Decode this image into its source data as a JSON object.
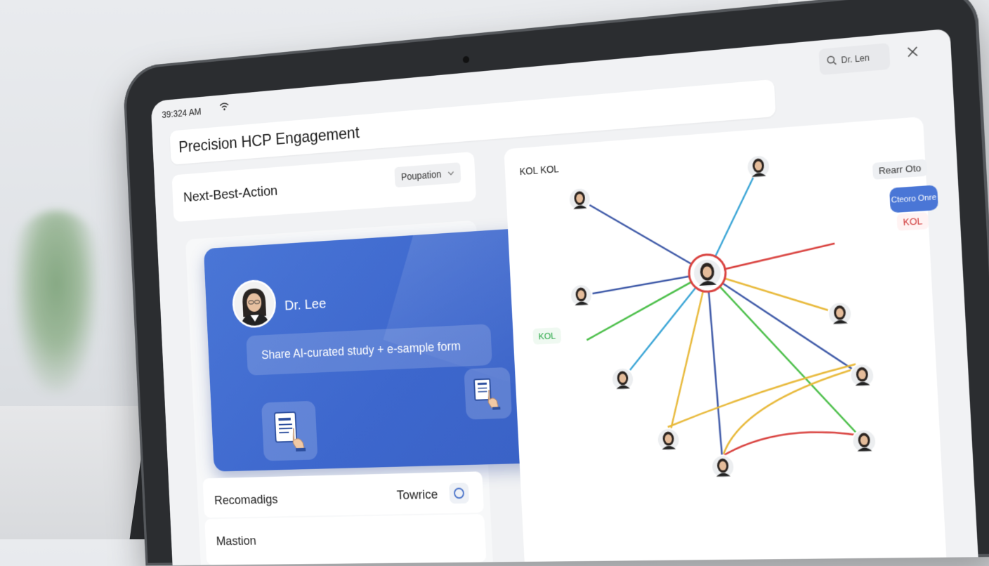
{
  "statusbar": {
    "time": "39:324 AM",
    "search_text": "Dr. Len"
  },
  "header": {
    "title": "Precision HCP Engagement"
  },
  "next_best_action": {
    "label": "Next-Best-Action",
    "dropdown_value": "Poupation"
  },
  "recommendation": {
    "doctor_name": "Dr. Lee",
    "action_text": "Share AI-curated study + e-sample form"
  },
  "list": {
    "row1_label": "Recomadigs",
    "row1_right": "Towrice",
    "row2_label": "Mastion"
  },
  "network": {
    "title": "KOL KOL",
    "tags": {
      "top": "Rearr Oto",
      "blue": "Cteoro Onre",
      "red": "KOL",
      "green": "KOL"
    },
    "colors": {
      "blue": "#3f5aa8",
      "sky": "#3aa5d6",
      "red": "#d9423f",
      "green": "#4cbf4a",
      "yellow": "#e8b93a"
    }
  }
}
